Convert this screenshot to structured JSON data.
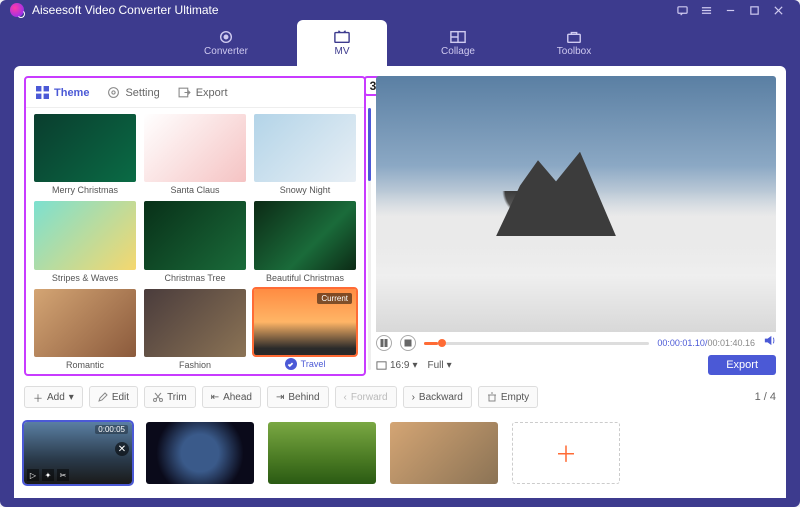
{
  "app_title": "Aiseesoft Video Converter Ultimate",
  "nav": {
    "converter": "Converter",
    "mv": "MV",
    "collage": "Collage",
    "toolbox": "Toolbox"
  },
  "tabs": {
    "theme": "Theme",
    "setting": "Setting",
    "export": "Export"
  },
  "badge": "3",
  "themes": [
    {
      "label": "Merry Christmas"
    },
    {
      "label": "Santa Claus"
    },
    {
      "label": "Snowy Night"
    },
    {
      "label": "Stripes & Waves"
    },
    {
      "label": "Christmas Tree"
    },
    {
      "label": "Beautiful Christmas"
    },
    {
      "label": "Romantic"
    },
    {
      "label": "Fashion"
    },
    {
      "label": "Travel",
      "selected": true,
      "current": "Current"
    }
  ],
  "preview": {
    "elapsed": "00:00:01.10",
    "total": "00:01:40.16",
    "ratio": "16:9",
    "full": "Full",
    "export": "Export"
  },
  "toolbar": {
    "add": "Add",
    "edit": "Edit",
    "trim": "Trim",
    "ahead": "Ahead",
    "behind": "Behind",
    "forward": "Forward",
    "backward": "Backward",
    "empty": "Empty",
    "counter_cur": "1",
    "counter_tot": "4"
  },
  "clips": [
    {
      "dur": "0:00:05"
    },
    {},
    {},
    {}
  ]
}
